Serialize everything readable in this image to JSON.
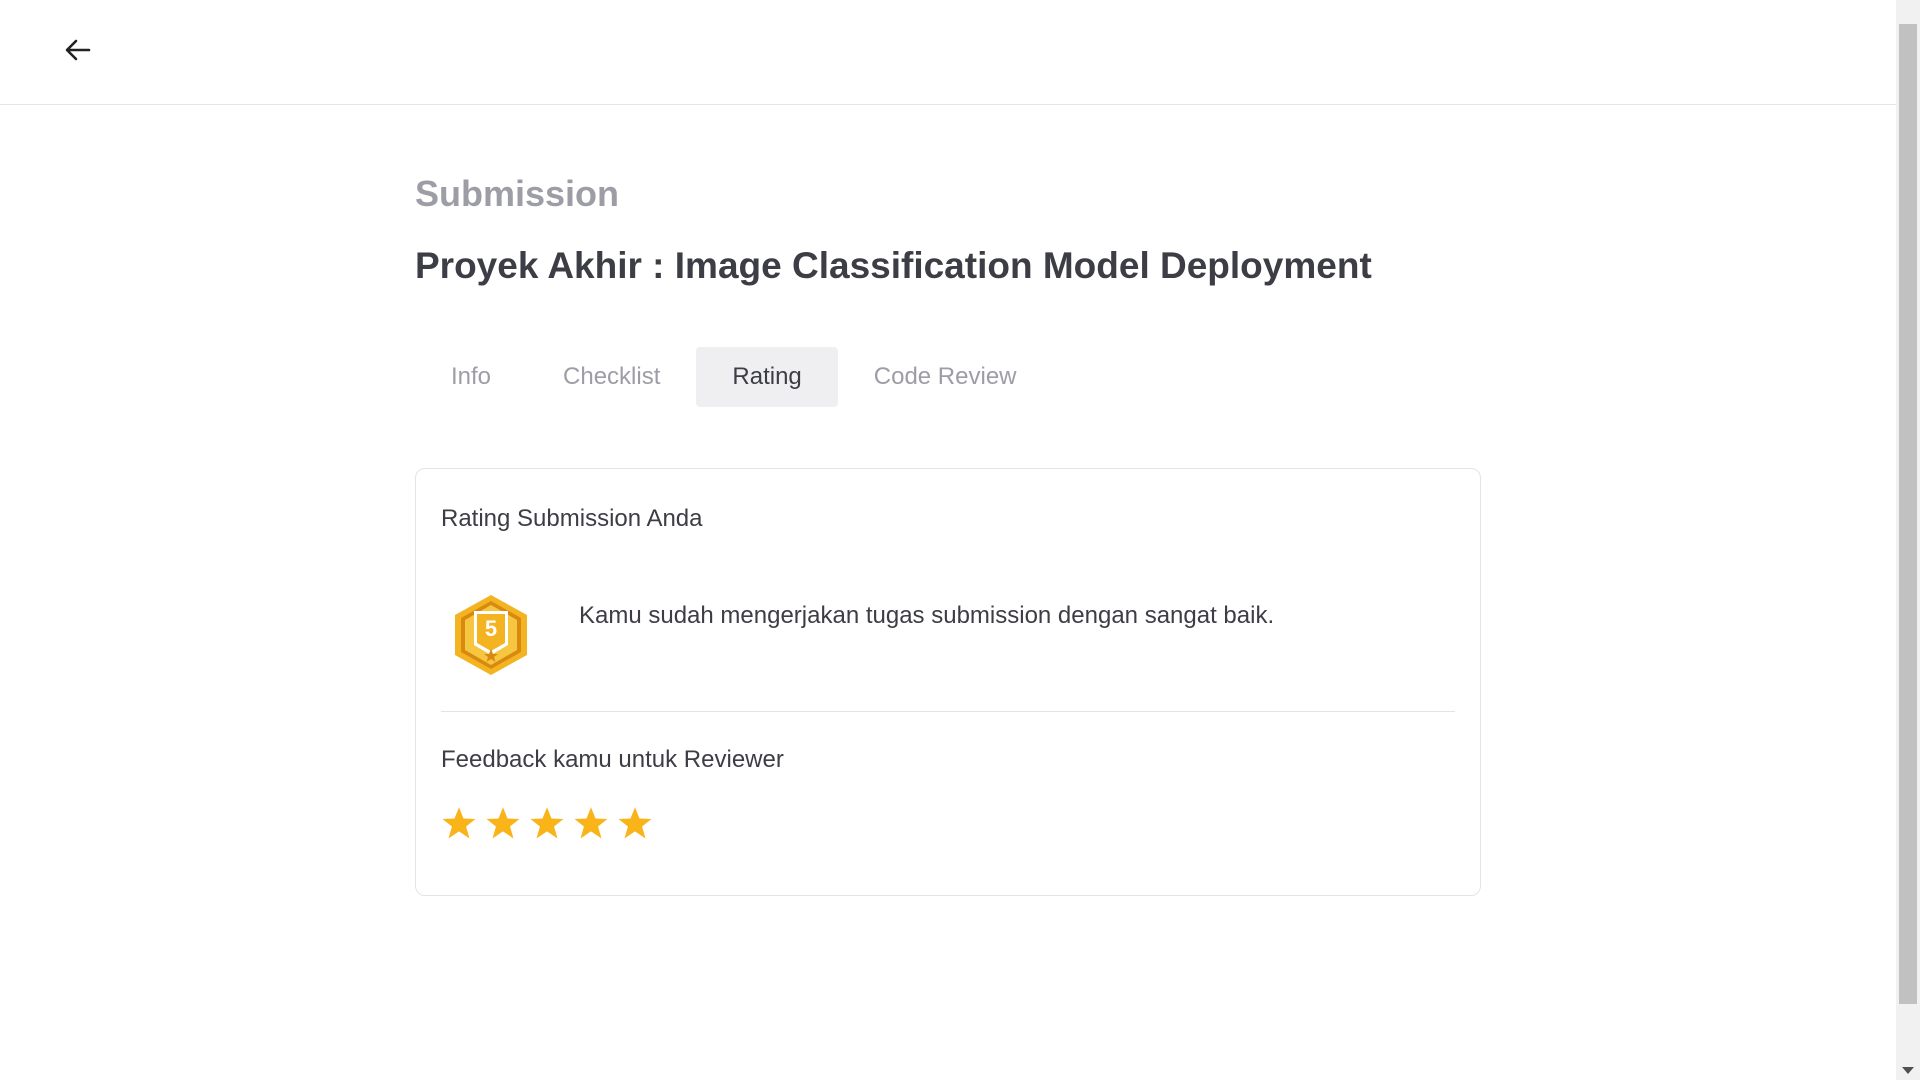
{
  "header": {
    "back_icon": "arrow-left-icon"
  },
  "page": {
    "eyebrow": "Submission",
    "title": "Proyek Akhir : Image Classification Model Deployment"
  },
  "tabs": [
    {
      "label": "Info",
      "active": false
    },
    {
      "label": "Checklist",
      "active": false
    },
    {
      "label": "Rating",
      "active": true
    },
    {
      "label": "Code Review",
      "active": false
    }
  ],
  "rating_card": {
    "heading": "Rating Submission Anda",
    "badge_value": "5",
    "badge_icon": "hexagon-rating-badge-icon",
    "message": "Kamu sudah mengerjakan tugas submission dengan sangat baik.",
    "feedback_heading": "Feedback kamu untuk Reviewer",
    "stars": 5,
    "max_stars": 5
  },
  "colors": {
    "star": "#f9b41a",
    "badge_gold": "#f4b320",
    "badge_dark": "#d88a10",
    "tab_active_bg": "#efeff1",
    "muted_text": "#9d9da6",
    "text": "#3d3d45"
  }
}
